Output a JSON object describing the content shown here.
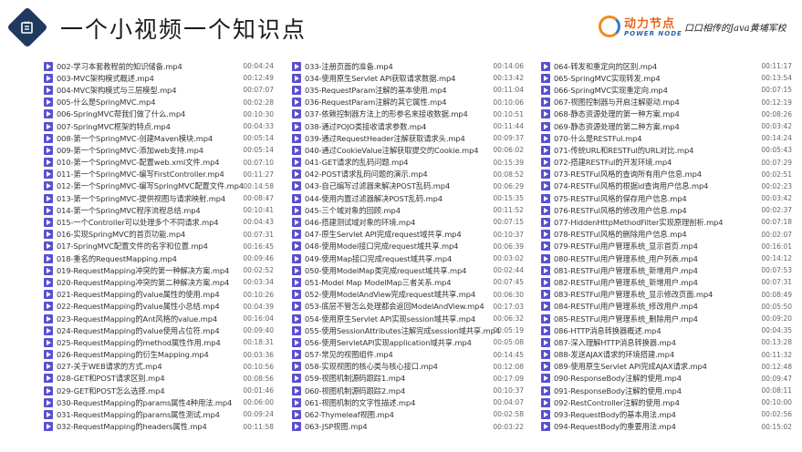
{
  "header": {
    "title": "一个小视频一个知识点",
    "brand_cn": "动力节点",
    "brand_en": "POWER NODE",
    "slogan": "口口相传的Java黄埔军校"
  },
  "columns": [
    [
      {
        "name": "002-学习本套教程前的知识储备.mp4",
        "duration": "00:04:24"
      },
      {
        "name": "003-MVC架构模式概述.mp4",
        "duration": "00:12:49"
      },
      {
        "name": "004-MVC架构模式与三层模型.mp4",
        "duration": "00:07:07"
      },
      {
        "name": "005-什么是SpringMVC.mp4",
        "duration": "00:02:28"
      },
      {
        "name": "006-SpringMVC帮我们做了什么.mp4",
        "duration": "00:10:30"
      },
      {
        "name": "007-SpringMVC框架的特点.mp4",
        "duration": "00:04:33"
      },
      {
        "name": "008-第一个SpringMVC-创建Maven模块.mp4",
        "duration": "00:05:14"
      },
      {
        "name": "009-第一个SpringMVC-添加web支持.mp4",
        "duration": "00:05:14"
      },
      {
        "name": "010-第一个SpringMVC-配置web.xml文件.mp4",
        "duration": "00:07:10"
      },
      {
        "name": "011-第一个SpringMVC-编写FirstController.mp4",
        "duration": "00:11:27"
      },
      {
        "name": "012-第一个SpringMVC-编写SpringMVC配置文件.mp4",
        "duration": "00:14:58"
      },
      {
        "name": "013-第一个SpringMVC-提供视图与请求映射.mp4",
        "duration": "00:08:47"
      },
      {
        "name": "014-第一个SpringMVC程序流程总结.mp4",
        "duration": "00:10:41"
      },
      {
        "name": "015-一个Controller可以处理多个不同请求.mp4",
        "duration": "00:04:43"
      },
      {
        "name": "016-实现SpringMVC的首页功能.mp4",
        "duration": "00:07:31"
      },
      {
        "name": "017-SpringMVC配置文件的名字和位置.mp4",
        "duration": "00:16:45"
      },
      {
        "name": "018-重名的RequestMapping.mp4",
        "duration": "00:09:46"
      },
      {
        "name": "019-RequestMapping冲突的第一种解决方案.mp4",
        "duration": "00:02:52"
      },
      {
        "name": "020-RequestMapping冲突的第二种解决方案.mp4",
        "duration": "00:03:34"
      },
      {
        "name": "021-RequestMapping的value属性的使用.mp4",
        "duration": "00:10:26"
      },
      {
        "name": "022-RequestMapping的value属性小总结.mp4",
        "duration": "00:04:39"
      },
      {
        "name": "023-RequestMapping的Ant风格的value.mp4",
        "duration": "00:16:04"
      },
      {
        "name": "024-RequestMapping的value使用占位符.mp4",
        "duration": "00:09:40"
      },
      {
        "name": "025-RequestMapping的method属性作用.mp4",
        "duration": "00:18:31"
      },
      {
        "name": "026-RequestMapping的衍生Mapping.mp4",
        "duration": "00:03:36"
      },
      {
        "name": "027-关于WEB请求的方式.mp4",
        "duration": "00:10:56"
      },
      {
        "name": "028-GET和POST请求区别.mp4",
        "duration": "00:08:56"
      },
      {
        "name": "029-GET和POST怎么选择.mp4",
        "duration": "00:01:46"
      },
      {
        "name": "030-RequestMapping的params属性4种用法.mp4",
        "duration": "00:06:00"
      },
      {
        "name": "031-RequestMapping的params属性测试.mp4",
        "duration": "00:09:24"
      },
      {
        "name": "032-RequestMapping的headers属性.mp4",
        "duration": "00:11:58"
      }
    ],
    [
      {
        "name": "033-注册页面的准备.mp4",
        "duration": "00:14:06"
      },
      {
        "name": "034-使用原生Servlet API获取请求数据.mp4",
        "duration": "00:13:42"
      },
      {
        "name": "035-RequestParam注解的基本使用.mp4",
        "duration": "00:11:04"
      },
      {
        "name": "036-RequestParam注解的其它属性.mp4",
        "duration": "00:10:06"
      },
      {
        "name": "037-依赖控制器方法上的形参名来接收数据.mp4",
        "duration": "00:10:51"
      },
      {
        "name": "038-通过POJO类接收请求参数.mp4",
        "duration": "00:11:44"
      },
      {
        "name": "039-通过RequestHeader注解获取请求头.mp4",
        "duration": "00:09:37"
      },
      {
        "name": "040-通过CookieValue注解获取提交的Cookie.mp4",
        "duration": "00:06:02"
      },
      {
        "name": "041-GET请求的乱码问题.mp4",
        "duration": "00:15:39"
      },
      {
        "name": "042-POST请求乱码问题的演示.mp4",
        "duration": "00:08:52"
      },
      {
        "name": "043-自己编写过滤器来解决POST乱码.mp4",
        "duration": "00:06:29"
      },
      {
        "name": "044-使用内置过滤器解决POST乱码.mp4",
        "duration": "00:15:35"
      },
      {
        "name": "045-三个域对象的回顾.mp4",
        "duration": "00:11:52"
      },
      {
        "name": "046-搭建测试域对象的环境.mp4",
        "duration": "00:07:15"
      },
      {
        "name": "047-原生Servlet API完成request域共享.mp4",
        "duration": "00:10:37"
      },
      {
        "name": "048-使用Model接口完成request域共享.mp4",
        "duration": "00:06:39"
      },
      {
        "name": "049-使用Map接口完成request域共享.mp4",
        "duration": "00:03:02"
      },
      {
        "name": "050-使用ModelMap类完成request域共享.mp4",
        "duration": "00:02:44"
      },
      {
        "name": "051-Model Map ModelMap三者关系.mp4",
        "duration": "00:07:45"
      },
      {
        "name": "052-使用ModelAndView完成request域共享.mp4",
        "duration": "00:06:30"
      },
      {
        "name": "053-底层不管怎么处理都会返回ModelAndView.mp4",
        "duration": "00:17:03"
      },
      {
        "name": "054-使用原生Servlet API实现session域共享.mp4",
        "duration": "00:06:32"
      },
      {
        "name": "055-使用SessionAttributes注解完成session域共享.mp4",
        "duration": "00:05:19"
      },
      {
        "name": "056-使用ServletAPI实现application域共享.mp4",
        "duration": "00:05:08"
      },
      {
        "name": "057-常见的视图组件.mp4",
        "duration": "00:14:45"
      },
      {
        "name": "058-实现视图的核心类与核心接口.mp4",
        "duration": "00:12:08"
      },
      {
        "name": "059-视图机制源码跟踪1.mp4",
        "duration": "00:17:09"
      },
      {
        "name": "060-视图机制源码跟踪2.mp4",
        "duration": "00:10:37"
      },
      {
        "name": "061-视图机制的文字性描述.mp4",
        "duration": "00:04:07"
      },
      {
        "name": "062-Thymeleaf视图.mp4",
        "duration": "00:02:58"
      },
      {
        "name": "063-JSP视图.mp4",
        "duration": "00:03:22"
      }
    ],
    [
      {
        "name": "064-转发和重定向的区别.mp4",
        "duration": "00:11:17"
      },
      {
        "name": "065-SpringMVC实现转发.mp4",
        "duration": "00:13:54"
      },
      {
        "name": "066-SpringMVC实现重定向.mp4",
        "duration": "00:07:15"
      },
      {
        "name": "067-视图控制器与开启注解驱动.mp4",
        "duration": "00:12:19"
      },
      {
        "name": "068-静态资源处理的第一种方案.mp4",
        "duration": "00:08:26"
      },
      {
        "name": "069-静态资源处理的第二种方案.mp4",
        "duration": "00:03:42"
      },
      {
        "name": "070-什么是RESTFul.mp4",
        "duration": "00:14:24"
      },
      {
        "name": "071-传统URL和RESTFul的URL对比.mp4",
        "duration": "00:05:43"
      },
      {
        "name": "072-搭建RESTFul的开发环境.mp4",
        "duration": "00:07:29"
      },
      {
        "name": "073-RESTFul风格的查询所有用户信息.mp4",
        "duration": "00:02:51"
      },
      {
        "name": "074-RESTFul风格的根据id查询用户信息.mp4",
        "duration": "00:02:23"
      },
      {
        "name": "075-RESTFul风格的保存用户信息.mp4",
        "duration": "00:03:42"
      },
      {
        "name": "076-RESTFul风格的修改用户信息.mp4",
        "duration": "00:02:37"
      },
      {
        "name": "077-HiddenHttpMethodFilter实现原理剖析.mp4",
        "duration": "00:07:18"
      },
      {
        "name": "078-RESTFul风格的删除用户信息.mp4",
        "duration": "00:02:07"
      },
      {
        "name": "079-RESTFul用户管理系统_显示首页.mp4",
        "duration": "00:16:01"
      },
      {
        "name": "080-RESTFul用户管理系统_用户列表.mp4",
        "duration": "00:14:12"
      },
      {
        "name": "081-RESTFul用户管理系统_新增用户.mp4",
        "duration": "00:07:53"
      },
      {
        "name": "082-RESTFul用户管理系统_新增用户.mp4",
        "duration": "00:07:31"
      },
      {
        "name": "083-RESTFul用户管理系统_显示修改页面.mp4",
        "duration": "00:08:49"
      },
      {
        "name": "084-RESTFul用户管理系统_修改用户.mp4",
        "duration": "00:05:50"
      },
      {
        "name": "085-RESTFul用户管理系统_删除用户.mp4",
        "duration": "00:09:20"
      },
      {
        "name": "086-HTTP消息转换器概述.mp4",
        "duration": "00:04:35"
      },
      {
        "name": "087-深入理解HTTP消息转换器.mp4",
        "duration": "00:13:28"
      },
      {
        "name": "088-发送AJAX请求的环境搭建.mp4",
        "duration": "00:11:32"
      },
      {
        "name": "089-使用原生Servlet API完成AJAX请求.mp4",
        "duration": "00:12:48"
      },
      {
        "name": "090-ResponseBody注解的使用.mp4",
        "duration": "00:09:47"
      },
      {
        "name": "091-ResponseBody注解的使用.mp4",
        "duration": "00:08:11"
      },
      {
        "name": "092-RestController注解的使用.mp4",
        "duration": "00:10:00"
      },
      {
        "name": "093-RequestBody的基本用法.mp4",
        "duration": "00:02:56"
      },
      {
        "name": "094-RequestBody的重要用法.mp4",
        "duration": "00:15:02"
      }
    ]
  ]
}
